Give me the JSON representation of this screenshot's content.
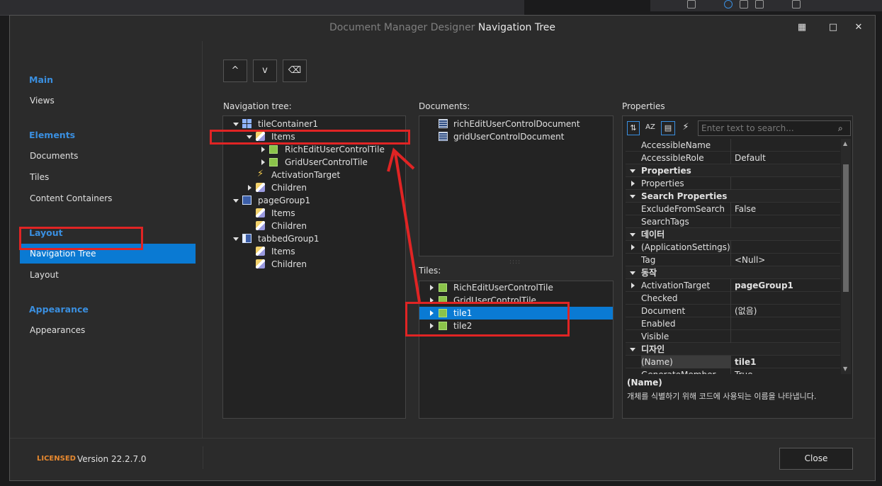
{
  "window": {
    "title_prefix": "Document Manager Designer",
    "title_main": "Navigation Tree",
    "controls": {
      "layout": "▦",
      "maximize": "□",
      "close": "✕"
    }
  },
  "nav": {
    "main_head": "Main",
    "views": "Views",
    "elements_head": "Elements",
    "documents": "Documents",
    "tiles": "Tiles",
    "content_containers": "Content Containers",
    "layout_head": "Layout",
    "navigation_tree": "Navigation Tree",
    "layout": "Layout",
    "appearance_head": "Appearance",
    "appearances": "Appearances"
  },
  "toolbar": {
    "up": "^",
    "down": "v",
    "erase": "⌫"
  },
  "labels": {
    "navigation_tree": "Navigation tree:",
    "documents": "Documents:",
    "tiles": "Tiles:",
    "properties": "Properties"
  },
  "tree": [
    {
      "text": "tileContainer1"
    },
    {
      "text": "Items"
    },
    {
      "text": "RichEditUserControlTile"
    },
    {
      "text": "GridUserControlTile"
    },
    {
      "text": "ActivationTarget"
    },
    {
      "text": "Children"
    },
    {
      "text": "pageGroup1"
    },
    {
      "text": "Items"
    },
    {
      "text": "Children"
    },
    {
      "text": "tabbedGroup1"
    },
    {
      "text": "Items"
    },
    {
      "text": "Children"
    }
  ],
  "documents": [
    "richEditUserControlDocument",
    "gridUserControlDocument"
  ],
  "tiles": [
    "RichEditUserControlTile",
    "GridUserControlTile",
    "tile1",
    "tile2"
  ],
  "properties": {
    "search_placeholder": "Enter text to search...",
    "rows": [
      {
        "k": "AccessibleName",
        "v": ""
      },
      {
        "k": "AccessibleRole",
        "v": "Default"
      },
      {
        "k": "Properties",
        "v": ""
      },
      {
        "k": "Properties",
        "v": ""
      },
      {
        "k": "Search Properties",
        "v": ""
      },
      {
        "k": "ExcludeFromSearch",
        "v": "False"
      },
      {
        "k": "SearchTags",
        "v": ""
      },
      {
        "k": "데이터",
        "v": ""
      },
      {
        "k": "(ApplicationSettings)",
        "v": ""
      },
      {
        "k": "Tag",
        "v": "<Null>"
      },
      {
        "k": "동작",
        "v": ""
      },
      {
        "k": "ActivationTarget",
        "v": "pageGroup1"
      },
      {
        "k": "Checked",
        "v": ""
      },
      {
        "k": "Document",
        "v": "(없음)"
      },
      {
        "k": "Enabled",
        "v": ""
      },
      {
        "k": "Visible",
        "v": ""
      },
      {
        "k": "디자인",
        "v": ""
      },
      {
        "k": "(Name)",
        "v": "tile1"
      },
      {
        "k": "GenerateMember",
        "v": "True"
      }
    ],
    "desc_title": "(Name)",
    "desc_text": "개체를 식별하기 위해 코드에 사용되는 이름을 나타냅니다."
  },
  "footer": {
    "licensed": "LICENSED",
    "version": "Version 22.2.7.0",
    "close": "Close"
  },
  "colors": {
    "accent": "#0a7ad3",
    "nav_heading": "#3a8fe0",
    "annotation": "#e02424",
    "licensed": "#e8892f"
  }
}
